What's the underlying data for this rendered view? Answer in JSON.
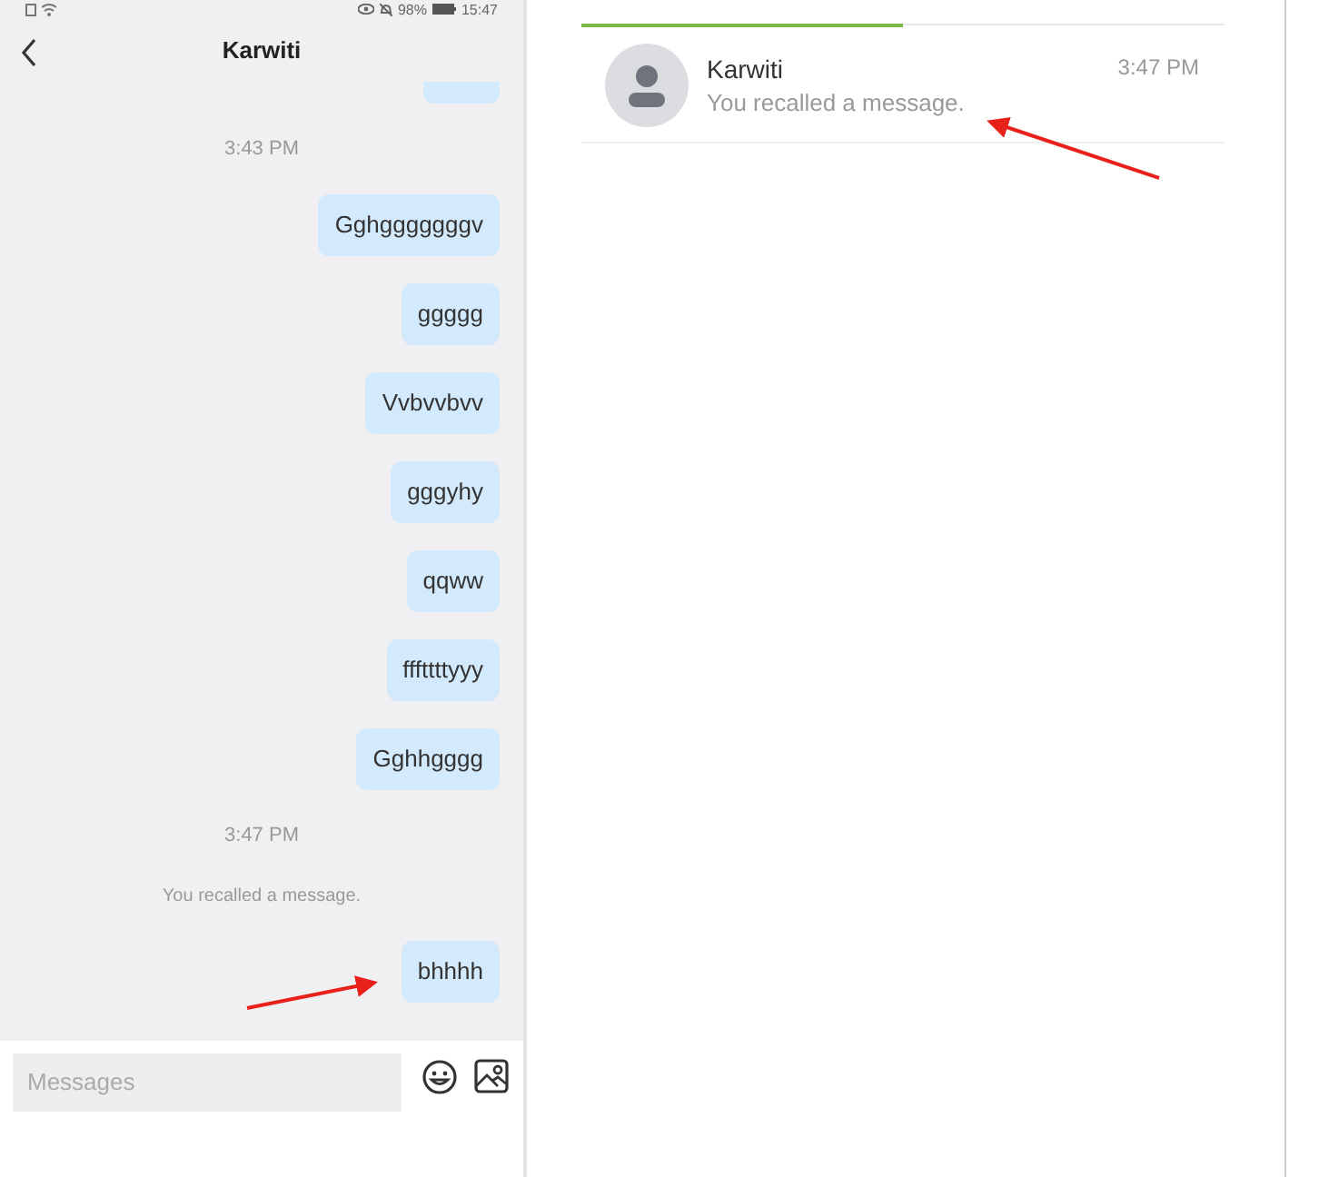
{
  "status_bar": {
    "battery": "98%",
    "time": "15:47"
  },
  "chat": {
    "title": "Karwiti",
    "messages": [
      {
        "kind": "clipped"
      },
      {
        "kind": "time",
        "text": "3:43 PM"
      },
      {
        "kind": "bubble",
        "text": "Gghgggggggv"
      },
      {
        "kind": "bubble",
        "text": "ggggg"
      },
      {
        "kind": "bubble",
        "text": "Vvbvvbvv"
      },
      {
        "kind": "bubble",
        "text": "gggyhy"
      },
      {
        "kind": "bubble",
        "text": "qqww"
      },
      {
        "kind": "bubble",
        "text": "fffttttyyy"
      },
      {
        "kind": "bubble",
        "text": "Gghhgggg"
      },
      {
        "kind": "time",
        "text": "3:47 PM"
      },
      {
        "kind": "notice",
        "text": "You recalled a message."
      },
      {
        "kind": "bubble",
        "text": "bhhhh"
      }
    ],
    "input": {
      "placeholder": "Messages"
    }
  },
  "tabs": [
    {
      "selected": true
    },
    {
      "selected": false
    }
  ],
  "conversations": [
    {
      "name": "Karwiti",
      "time": "3:47 PM",
      "preview": "You recalled a message."
    }
  ]
}
